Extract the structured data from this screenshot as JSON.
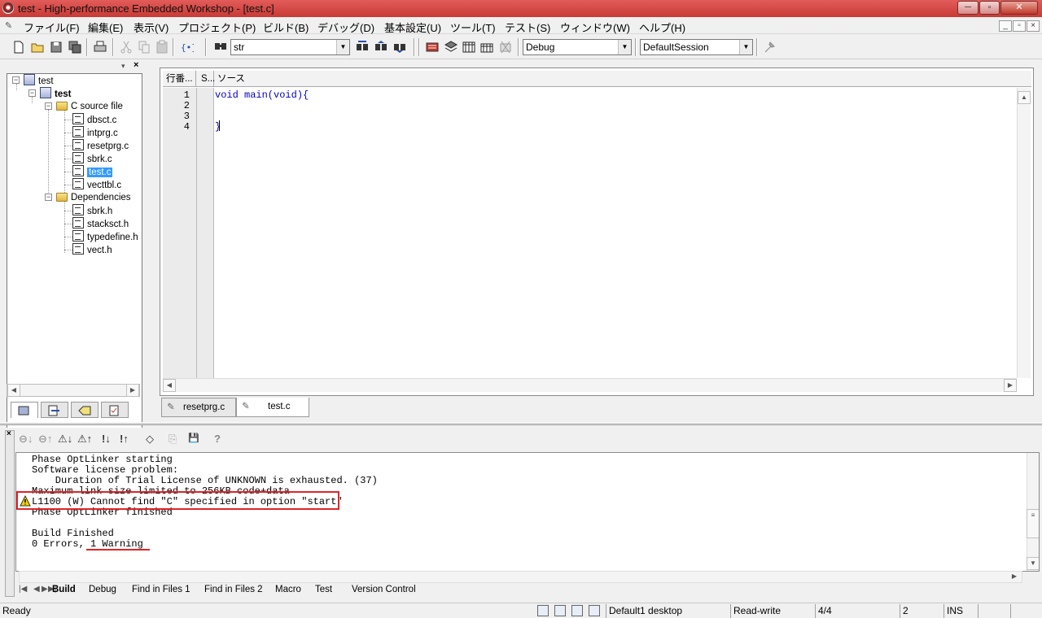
{
  "window": {
    "title": "test - High-performance Embedded Workshop - [test.c]",
    "minimize_glyph": "─",
    "maximize_glyph": "▫",
    "close_glyph": "✕"
  },
  "menu": {
    "items": [
      "ファイル(F)",
      "編集(E)",
      "表示(V)",
      "プロジェクト(P)",
      "ビルド(B)",
      "デバッグ(D)",
      "基本設定(U)",
      "ツール(T)",
      "テスト(S)",
      "ウィンドウ(W)",
      "ヘルプ(H)"
    ],
    "mdi_min": "_",
    "mdi_restore": "▫",
    "mdi_close": "×"
  },
  "toolbar": {
    "find_combo_value": "str",
    "config_combo_value": "Debug",
    "session_combo_value": "DefaultSession"
  },
  "workspace": {
    "tree": [
      {
        "label": "test",
        "bold": false
      },
      {
        "label": "test",
        "bold": true
      },
      {
        "label": "C source file"
      },
      {
        "label": "dbsct.c"
      },
      {
        "label": "intprg.c"
      },
      {
        "label": "resetprg.c"
      },
      {
        "label": "sbrk.c"
      },
      {
        "label": "test.c",
        "selected": true
      },
      {
        "label": "vecttbl.c"
      },
      {
        "label": "Dependencies"
      },
      {
        "label": "sbrk.h"
      },
      {
        "label": "stacksct.h"
      },
      {
        "label": "typedefine.h"
      },
      {
        "label": "vect.h"
      }
    ]
  },
  "editor": {
    "col_line": "行番...",
    "col_s": "S...",
    "col_source": "ソース",
    "line_numbers": [
      "1",
      "2",
      "3",
      "4"
    ],
    "code": [
      "void main(void){",
      "",
      "",
      "}"
    ],
    "tabs": [
      "resetprg.c",
      "test.c"
    ],
    "active_tab": "test.c"
  },
  "output": {
    "lines": [
      "Phase OptLinker starting",
      "Software license problem:",
      "    Duration of Trial License of UNKNOWN is exhausted. (37)",
      "Maximum link size limited to 256KB code+data",
      "L1100 (W) Cannot find \"C\" specified in option \"start\"",
      "Phase OptLinker finished",
      "",
      "Build Finished",
      "0 Errors, 1 Warning"
    ],
    "tabs": [
      "Build",
      "Debug",
      "Find in Files 1",
      "Find in Files 2",
      "Macro",
      "Test",
      "Version Control"
    ],
    "active_tab": "Build",
    "toolbar_glyphs": [
      "⊖↓",
      "⊖↑",
      "⚠↓",
      "⚠↑",
      "!↓",
      "!↑",
      "◇",
      "⎘",
      "💾",
      "?"
    ]
  },
  "statusbar": {
    "ready": "Ready",
    "desktop": "Default1 desktop",
    "mode": "Read-write",
    "position": "4/4",
    "column": "2",
    "insert": "INS"
  },
  "colors": {
    "titlebar": "#d24b47",
    "highlight": "#e0242a",
    "keyword": "#0000c0",
    "selection": "#3399ff"
  }
}
